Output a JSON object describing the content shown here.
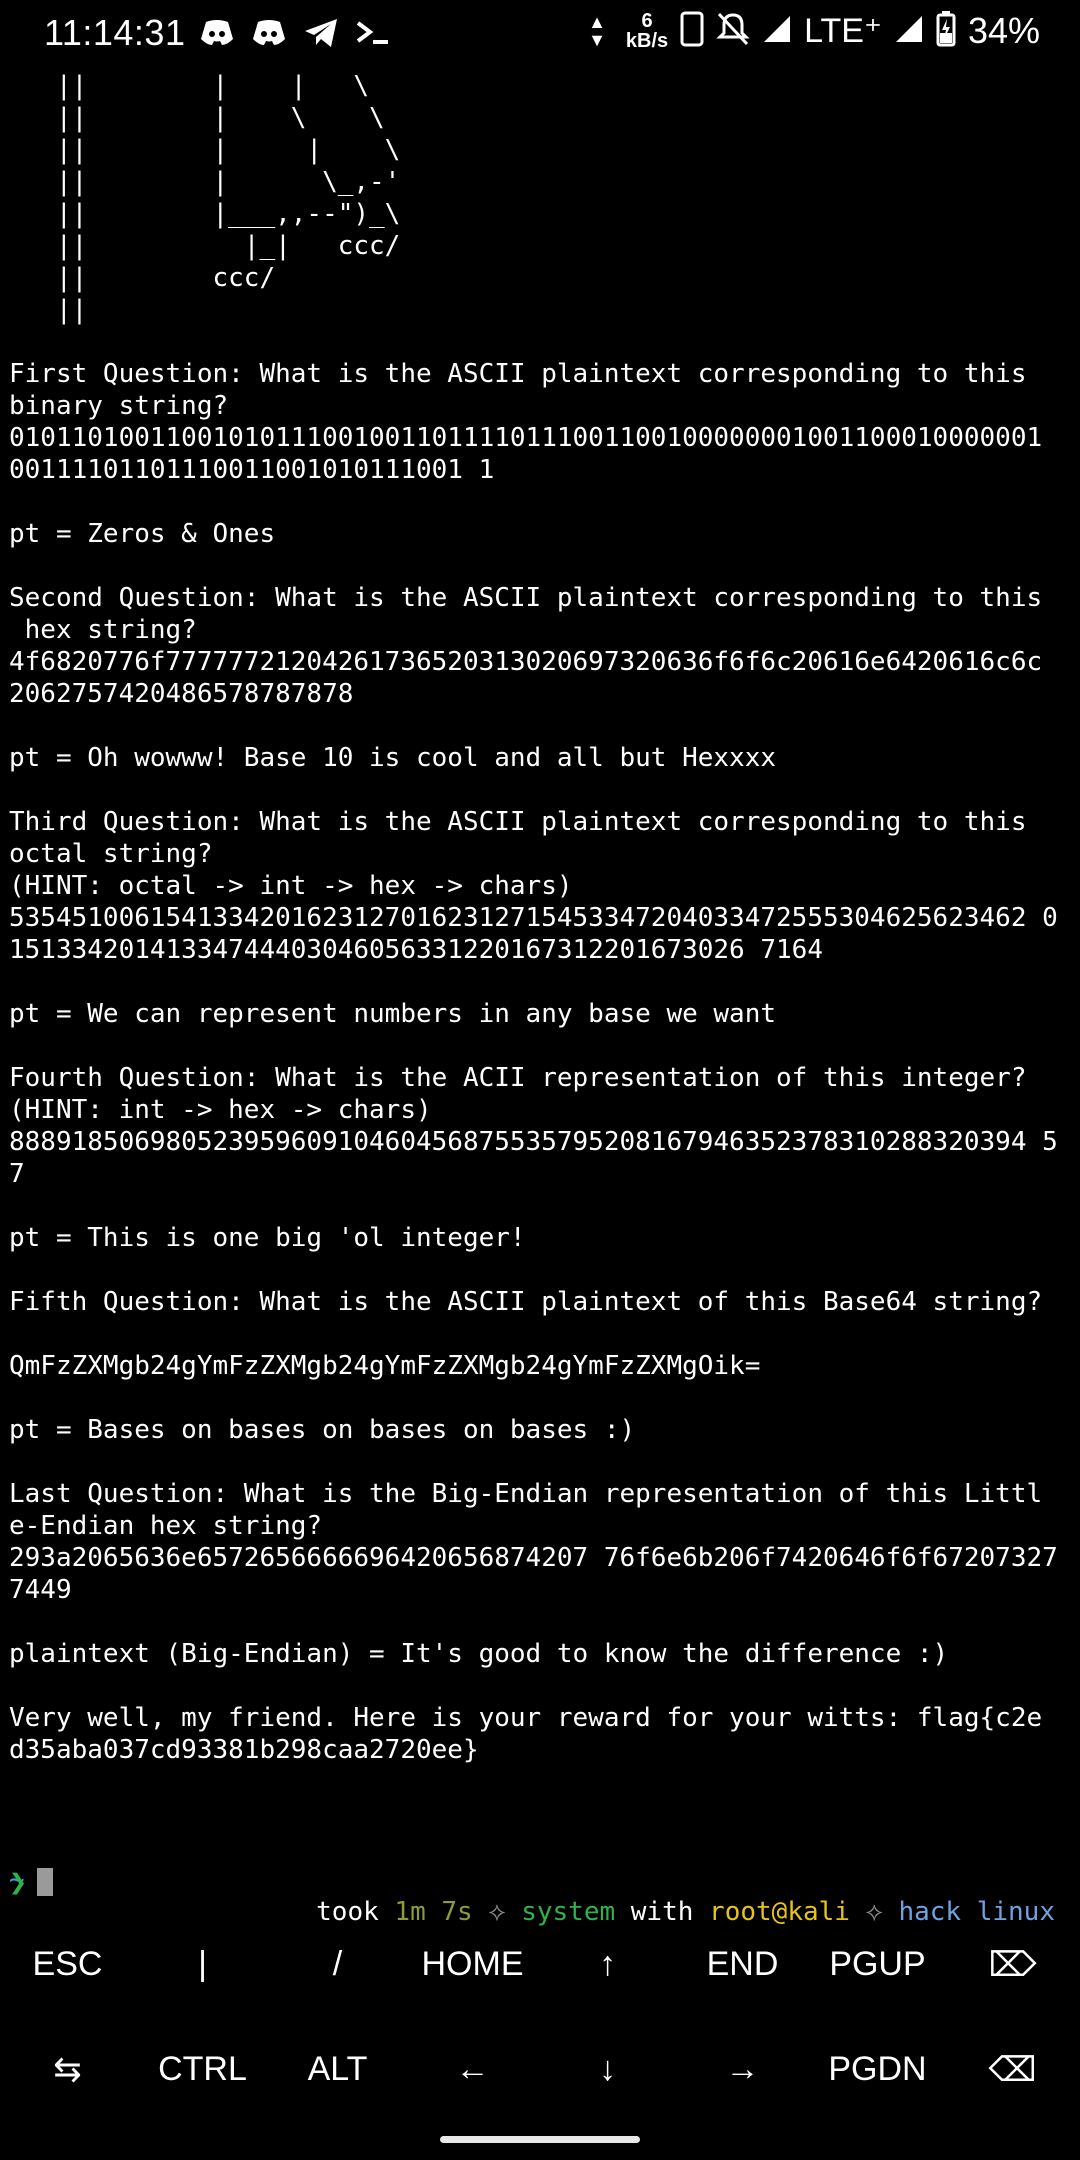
{
  "status_bar": {
    "time": "11:14:31",
    "net_speed_value": "6",
    "net_speed_unit": "kB/s",
    "network_type": "LTE⁺",
    "battery_percent": "34%",
    "left_icons": [
      "discord-icon",
      "discord-icon",
      "telegram-icon",
      "terminal-icon"
    ],
    "right_icons": [
      "phone-icon",
      "notifications-off-icon",
      "signal-icon",
      "lte-label",
      "signal-icon",
      "battery-charging-icon"
    ]
  },
  "terminal": {
    "output": "   ||        |    |   \\\n   ||        |    \\    \\\n   ||        |     |    \\\n   ||        |      \\_,-'\n   ||        |___,,--\")_\\\n   ||          |_|   ccc/\n   ||        ccc/\n   ||\n\nFirst Question: What is the ASCII plaintext corresponding to this\nbinary string?\n010110100110010101110010011011110111001100100000001001100010000001\n00111101101110011001010111001 1\n\npt = Zeros & Ones\n\nSecond Question: What is the ASCII plaintext corresponding to this\n hex string?\n4f6820776f77777721204261736520313020697320636f6f6c20616e6420616c6c\n2062757420486578787878\n\npt = Oh wowww! Base 10 is cool and all but Hexxxx\n\nThird Question: What is the ASCII plaintext corresponding to this\noctal string?\n(HINT: octal -> int -> hex -> chars)\n53545100615413342016231270162312715453347204033472555304625623462 0\n15133420141334744403046056331220167312201673026 7164\n\npt = We can represent numbers in any base we want\n\nFourth Question: What is the ACII representation of this integer?\n(HINT: int -> hex -> chars)\n88891850698052395960910460456875535795208167946352378310288320394 5\n7\n\npt = This is one big 'ol integer!\n\nFifth Question: What is the ASCII plaintext of this Base64 string?\n\nQmFzZXMgb24gYmFzZXMgb24gYmFzZXMgb24gYmFzZXMgOik=\n\npt = Bases on bases on bases on bases :)\n\nLast Question: What is the Big-Endian representation of this Littl\ne-Endian hex string?\n293a2065636e6572656666696420656874207 76f6e6b206f7420646f6f67207327\n7449\n\nplaintext (Big-Endian) = It's good to know the difference :)\n\nVery well, my friend. Here is your reward for your witts: flag{c2e\nd35aba037cd93381b298caa2720ee}",
    "prompt": {
      "tilde": "~",
      "took": "took ",
      "duration": "1m 7s",
      "sep1": " ⟡ ",
      "system": "system",
      "with": " with ",
      "user_host": "root@kali",
      "sep2": " ⟡ ",
      "hack": "hack",
      "space": " ",
      "linux": "linux",
      "arrow": "❯"
    }
  },
  "extra_keys": {
    "row1": [
      "ESC",
      "|",
      "/",
      "HOME",
      "↑",
      "END",
      "PGUP",
      "⌦"
    ],
    "row2": [
      "⇆",
      "CTRL",
      "ALT",
      "←",
      "↓",
      "→",
      "PGDN",
      "⌫"
    ]
  }
}
